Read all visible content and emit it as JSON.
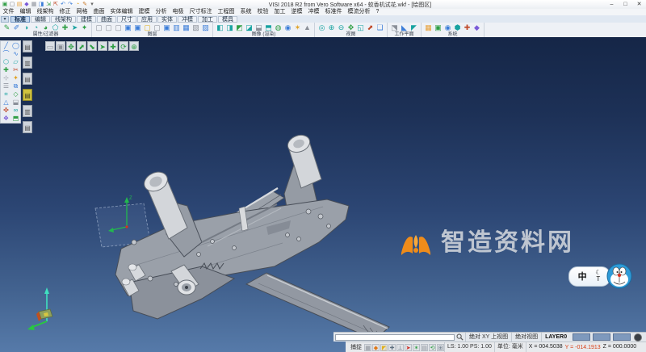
{
  "window": {
    "title": "VISI 2018 R2 from Vero Software x64 - 蚊香机试花.wkf - [绘图区]",
    "controls": {
      "minimize": "–",
      "maximize": "□",
      "close": "✕"
    }
  },
  "quick_access": {
    "icons": [
      {
        "name": "app-icon",
        "glyph": "▣",
        "color": "#2f9e44"
      },
      {
        "name": "new-file-icon",
        "glyph": "▢",
        "color": "#6a7078"
      },
      {
        "name": "open-folder-icon",
        "glyph": "▤",
        "color": "#e8a13a"
      },
      {
        "name": "save-icon",
        "glyph": "◆",
        "color": "#7a5ad8"
      },
      {
        "name": "print-icon",
        "glyph": "▦",
        "color": "#8a8f98"
      },
      {
        "name": "preview-icon",
        "glyph": "◨",
        "color": "#3b7dd8"
      },
      {
        "name": "import-icon",
        "glyph": "⇲",
        "color": "#2f9e44"
      },
      {
        "name": "export-icon",
        "glyph": "⇱",
        "color": "#c04828"
      },
      {
        "name": "undo-icon",
        "glyph": "↶",
        "color": "#3b7dd8"
      },
      {
        "name": "redo-icon",
        "glyph": "↷",
        "color": "#3b7dd8"
      },
      {
        "name": "recent-icon",
        "glyph": "◔",
        "color": "#e0a020"
      },
      {
        "name": "edit-icon",
        "glyph": "✎",
        "color": "#c87828"
      },
      {
        "name": "dropdown-icon",
        "glyph": "▾",
        "color": "#666666"
      }
    ]
  },
  "menu": {
    "items": [
      {
        "name": "menu-file",
        "label": "文件"
      },
      {
        "name": "menu-edit",
        "label": "编辑"
      },
      {
        "name": "menu-wireframe",
        "label": "线架构"
      },
      {
        "name": "menu-modify",
        "label": "修正"
      },
      {
        "name": "menu-mesh",
        "label": "网格"
      },
      {
        "name": "menu-surface",
        "label": "曲面"
      },
      {
        "name": "menu-solid-edit",
        "label": "实体编辑"
      },
      {
        "name": "menu-modeling",
        "label": "建模"
      },
      {
        "name": "menu-analysis",
        "label": "分析"
      },
      {
        "name": "menu-electrode",
        "label": "电极"
      },
      {
        "name": "menu-dimension",
        "label": "尺寸标注"
      },
      {
        "name": "menu-drafting",
        "label": "工程图"
      },
      {
        "name": "menu-system",
        "label": "系统"
      },
      {
        "name": "menu-verify",
        "label": "校验"
      },
      {
        "name": "menu-machining",
        "label": "加工"
      },
      {
        "name": "menu-mold",
        "label": "逆模"
      },
      {
        "name": "menu-die",
        "label": "冲模"
      },
      {
        "name": "menu-standard-parts",
        "label": "标准件"
      },
      {
        "name": "menu-flow-analysis",
        "label": "模流分析"
      },
      {
        "name": "menu-help",
        "label": "?"
      }
    ]
  },
  "tabs": {
    "dropdown_glyph": "▾",
    "items": [
      {
        "name": "tab-standard",
        "label": "标准",
        "active": true
      },
      {
        "name": "tab-edit",
        "label": "编辑"
      },
      {
        "name": "tab-wireframe",
        "label": "线架构"
      },
      {
        "name": "tab-modeling",
        "label": "建模"
      },
      {
        "name": "tab-surface",
        "label": "曲面"
      },
      {
        "name": "tab-dimension",
        "label": "尺寸"
      },
      {
        "name": "tab-application",
        "label": "应用"
      },
      {
        "name": "tab-solid",
        "label": "实体"
      },
      {
        "name": "tab-die",
        "label": "冲模"
      },
      {
        "name": "tab-machining",
        "label": "加工"
      },
      {
        "name": "tab-mold",
        "label": "模具"
      }
    ]
  },
  "toolbar_groups": [
    {
      "caption": "属性/过滤器",
      "icons": [
        {
          "name": "attr-pen-icon",
          "glyph": "✎",
          "color": "#2f9e44"
        },
        {
          "name": "attr-edit-icon",
          "glyph": "✐",
          "color": "#3b7dd8"
        },
        {
          "name": "filter-half-icon",
          "glyph": "◑",
          "color": "#17a2a0"
        },
        {
          "name": "filter-quarter-icon",
          "glyph": "◔",
          "color": "#17a2a0"
        },
        {
          "name": "filter-most-icon",
          "glyph": "◕",
          "color": "#2f9e44"
        },
        {
          "name": "filter-shape-icon",
          "glyph": "⬠",
          "color": "#17a2a0"
        },
        {
          "name": "attr-add-icon",
          "glyph": "✚",
          "color": "#2f9e44"
        },
        {
          "name": "attr-pick-icon",
          "glyph": "➤",
          "color": "#17a2a0"
        },
        {
          "name": "attr-star-icon",
          "glyph": "✦",
          "color": "#2f9e44"
        }
      ]
    },
    {
      "caption": "图层",
      "icons": [
        {
          "name": "layer-1-icon",
          "glyph": "▢",
          "color": "#8a8f98"
        },
        {
          "name": "layer-2-icon",
          "glyph": "▢",
          "color": "#8a8f98"
        },
        {
          "name": "layer-3-icon",
          "glyph": "▢",
          "color": "#8a8f98"
        },
        {
          "name": "layer-4-icon",
          "glyph": "▣",
          "color": "#3b7dd8"
        },
        {
          "name": "layer-5-icon",
          "glyph": "▣",
          "color": "#3b7dd8"
        },
        {
          "name": "layer-6-icon",
          "glyph": "▢",
          "color": "#e0b020"
        },
        {
          "name": "layer-7-icon",
          "glyph": "▢",
          "color": "#8a8f98"
        },
        {
          "name": "layer-8-icon",
          "glyph": "▣",
          "color": "#3b7dd8"
        },
        {
          "name": "layer-9-icon",
          "glyph": "▥",
          "color": "#3b7dd8"
        },
        {
          "name": "layer-10-icon",
          "glyph": "▦",
          "color": "#3b7dd8"
        },
        {
          "name": "layer-11-icon",
          "glyph": "▧",
          "color": "#8a8f98"
        },
        {
          "name": "layer-12-icon",
          "glyph": "▨",
          "color": "#3b7dd8"
        }
      ]
    },
    {
      "caption": "图像 (渲染)",
      "icons": [
        {
          "name": "render-shade-icon",
          "glyph": "◧",
          "color": "#17a2a0"
        },
        {
          "name": "render-shade2-icon",
          "glyph": "◨",
          "color": "#17a2a0"
        },
        {
          "name": "render-hidden-icon",
          "glyph": "◩",
          "color": "#2f9e44"
        },
        {
          "name": "render-wire-icon",
          "glyph": "◪",
          "color": "#17a2a0"
        },
        {
          "name": "render-flat-icon",
          "glyph": "⬓",
          "color": "#8a8f98"
        },
        {
          "name": "render-gouraud-icon",
          "glyph": "⬒",
          "color": "#17a2a0"
        },
        {
          "name": "render-texture-icon",
          "glyph": "◍",
          "color": "#2f9e44"
        },
        {
          "name": "render-light-icon",
          "glyph": "◉",
          "color": "#3b7dd8"
        },
        {
          "name": "render-sun-icon",
          "glyph": "✶",
          "color": "#e0a020"
        },
        {
          "name": "render-prism-icon",
          "glyph": "▲",
          "color": "#8a8f98"
        }
      ]
    },
    {
      "caption": "视图",
      "icons": [
        {
          "name": "view-zoom-icon",
          "glyph": "◎",
          "color": "#17a2a0"
        },
        {
          "name": "view-zoom-in-icon",
          "glyph": "⊕",
          "color": "#17a2a0"
        },
        {
          "name": "view-zoom-out-icon",
          "glyph": "⊖",
          "color": "#17a2a0"
        },
        {
          "name": "view-pan-icon",
          "glyph": "✥",
          "color": "#2f9e44"
        },
        {
          "name": "view-corner-icon",
          "glyph": "◱",
          "color": "#17a2a0"
        },
        {
          "name": "view-rotate-icon",
          "glyph": "⬈",
          "color": "#c04828"
        },
        {
          "name": "view-window-icon",
          "glyph": "❏",
          "color": "#3b7dd8"
        }
      ]
    },
    {
      "caption": "工作平面",
      "icons": [
        {
          "name": "workplane-icon",
          "glyph": "⬔",
          "color": "#8a8f98"
        },
        {
          "name": "workplane-xy-icon",
          "glyph": "◣",
          "color": "#3b7dd8"
        },
        {
          "name": "workplane-iso-icon",
          "glyph": "◤",
          "color": "#17a2a0"
        }
      ]
    },
    {
      "caption": "系统",
      "icons": [
        {
          "name": "system-grid-icon",
          "glyph": "▦",
          "color": "#e8a13a"
        },
        {
          "name": "system-box-icon",
          "glyph": "▣",
          "color": "#2f9e44"
        },
        {
          "name": "system-target-icon",
          "glyph": "◉",
          "color": "#3b7dd8"
        },
        {
          "name": "system-hex-icon",
          "glyph": "⬢",
          "color": "#17a2a0"
        },
        {
          "name": "system-plus-icon",
          "glyph": "✚",
          "color": "#c04828"
        },
        {
          "name": "system-gem-icon",
          "glyph": "◆",
          "color": "#7a5ad8"
        }
      ]
    }
  ],
  "left_toolbar": {
    "icons": [
      {
        "name": "line-tool-icon",
        "glyph": "╱",
        "color": "#3b7dd8"
      },
      {
        "name": "circle-tool-icon",
        "glyph": "◯",
        "color": "#3b7dd8"
      },
      {
        "name": "arc-tool-icon",
        "glyph": "⌒",
        "color": "#3b7dd8"
      },
      {
        "name": "spline-tool-icon",
        "glyph": "∿",
        "color": "#3b7dd8"
      },
      {
        "name": "polygon-tool-icon",
        "glyph": "⬡",
        "color": "#17a2a0"
      },
      {
        "name": "rect-tool-icon",
        "glyph": "▱",
        "color": "#17a2a0"
      },
      {
        "name": "add-geo-icon",
        "glyph": "✚",
        "color": "#2f9e44"
      },
      {
        "name": "trim-tool-icon",
        "glyph": "✂",
        "color": "#c04828"
      },
      {
        "name": "point-tool-icon",
        "glyph": "⊹",
        "color": "#8a8f98"
      },
      {
        "name": "star-tool-icon",
        "glyph": "✦",
        "color": "#e0a020"
      },
      {
        "name": "list-tool-icon",
        "glyph": "☰",
        "color": "#8a8f98"
      },
      {
        "name": "copy-tool-icon",
        "glyph": "⧉",
        "color": "#3b7dd8"
      },
      {
        "name": "hatch-tool-icon",
        "glyph": "⌗",
        "color": "#17a2a0"
      },
      {
        "name": "diamond-tool-icon",
        "glyph": "◇",
        "color": "#2f9e44"
      },
      {
        "name": "triangle-tool-icon",
        "glyph": "△",
        "color": "#3b7dd8"
      },
      {
        "name": "half-square-icon",
        "glyph": "⬓",
        "color": "#8a8f98"
      },
      {
        "name": "cross-tool-icon",
        "glyph": "✜",
        "color": "#c04828"
      },
      {
        "name": "loop-tool-icon",
        "glyph": "∞",
        "color": "#17a2a0"
      },
      {
        "name": "gem-tool-icon",
        "glyph": "❖",
        "color": "#7a5ad8"
      },
      {
        "name": "flip-tool-icon",
        "glyph": "⬒",
        "color": "#2f9e44"
      }
    ]
  },
  "side_toolbar": {
    "icons": [
      {
        "name": "doc-panel-1-icon",
        "glyph": "▤",
        "color": "#555555"
      },
      {
        "name": "doc-panel-2-icon",
        "glyph": "▥",
        "color": "#555555"
      },
      {
        "name": "doc-panel-3-icon",
        "glyph": "▤",
        "color": "#555555"
      },
      {
        "name": "doc-panel-4-icon",
        "glyph": "▤",
        "color": "#444422",
        "active": true
      },
      {
        "name": "doc-panel-5-icon",
        "glyph": "▥",
        "color": "#555555"
      },
      {
        "name": "doc-panel-6-icon",
        "glyph": "▤",
        "color": "#555555"
      }
    ]
  },
  "floating_toolbar": {
    "icons": [
      {
        "name": "select-box-icon",
        "glyph": "▭",
        "color": "#8a8f98"
      },
      {
        "name": "select-fill-icon",
        "glyph": "▣",
        "color": "#8a8f98"
      },
      {
        "name": "move-icon",
        "glyph": "✥",
        "color": "#2f9e44"
      },
      {
        "name": "arrow-up-right-icon",
        "glyph": "⬈",
        "color": "#2f9e44"
      },
      {
        "name": "arrow-down-right-icon",
        "glyph": "⬊",
        "color": "#2f9e44"
      },
      {
        "name": "play-icon",
        "glyph": "➤",
        "color": "#2f9e44"
      },
      {
        "name": "plus-icon",
        "glyph": "✚",
        "color": "#2f9e44"
      },
      {
        "name": "rotate-icon",
        "glyph": "⟳",
        "color": "#2f9e44"
      },
      {
        "name": "target-icon",
        "glyph": "⊕",
        "color": "#2f9e44"
      }
    ]
  },
  "viewport": {
    "axis_label_z": "Z",
    "watermark": {
      "text": "智造资料网",
      "logo_color": "#ef8c1a",
      "text_color": "#c6ccd5"
    }
  },
  "ime": {
    "lang_indicator": "中",
    "moon_glyph": "☾",
    "shirt_glyph": "T"
  },
  "status_bar_top": {
    "search_placeholder": "",
    "view_mode": "绝对 XY 上视图",
    "view_ref": "绝对视图",
    "layer": "LAYER0",
    "swatches": [
      {
        "name": "color-swatch-1",
        "glyph": "",
        "bg": "#7e99bd"
      },
      {
        "name": "color-swatch-2",
        "glyph": "",
        "bg": "#7e99bd"
      },
      {
        "name": "color-swatch-3",
        "glyph": "",
        "bg": "#7e99bd"
      }
    ]
  },
  "status_bar_bottom": {
    "snap_label": "捕捉",
    "icons": [
      {
        "name": "snap-grid-icon",
        "glyph": "▦",
        "color": "#8a8f98"
      },
      {
        "name": "snap-point-icon",
        "glyph": "◆",
        "color": "#e07818"
      },
      {
        "name": "snap-mid-icon",
        "glyph": "◩",
        "color": "#e0b020"
      },
      {
        "name": "snap-cross-icon",
        "glyph": "✚",
        "color": "#607080"
      },
      {
        "name": "snap-perp-icon",
        "glyph": "⊥",
        "color": "#607080"
      },
      {
        "name": "snap-arrow-icon",
        "glyph": "➤",
        "color": "#d03028"
      },
      {
        "name": "snap-star-icon",
        "glyph": "✶",
        "color": "#2f9e44"
      },
      {
        "name": "snap-layer-icon",
        "glyph": "▤",
        "color": "#8a8f98"
      },
      {
        "name": "refresh-icon",
        "glyph": "⟲",
        "color": "#2f9e44"
      },
      {
        "name": "grid-toggle-icon",
        "glyph": "⊞",
        "color": "#607080"
      }
    ],
    "ls_ps": "LS: 1.00 PS: 1.00",
    "units": "单位: 毫米",
    "coord_x": "X = 004.5038",
    "coord_y": "Y = -014.1913",
    "coord_z": "Z = 000.0000"
  }
}
